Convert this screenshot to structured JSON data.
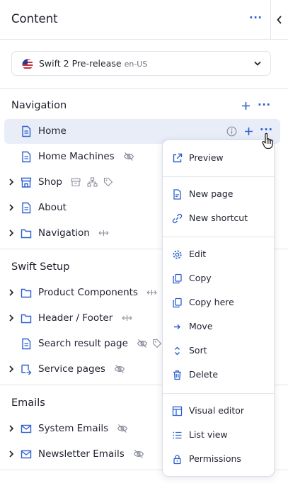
{
  "header": {
    "title": "Content",
    "menu_label": "•••"
  },
  "site_selector": {
    "value": "Swift 2 Pre-release",
    "locale": "en-US"
  },
  "navigation_section": {
    "title": "Navigation",
    "items": [
      {
        "label": "Home"
      },
      {
        "label": "Home Machines"
      },
      {
        "label": "Shop"
      },
      {
        "label": "About"
      },
      {
        "label": "Navigation"
      }
    ]
  },
  "swift_setup_section": {
    "title": "Swift Setup",
    "items": [
      {
        "label": "Product Components"
      },
      {
        "label": "Header / Footer"
      },
      {
        "label": "Search result page"
      },
      {
        "label": "Service pages"
      }
    ]
  },
  "emails_section": {
    "title": "Emails",
    "items": [
      {
        "label": "System Emails"
      },
      {
        "label": "Newsletter Emails"
      }
    ]
  },
  "context_menu": {
    "items": [
      {
        "label": "Preview",
        "icon": "external-link-icon"
      },
      {
        "label": "New page",
        "icon": "new-page-icon"
      },
      {
        "label": "New shortcut",
        "icon": "link-icon"
      },
      {
        "label": "Edit",
        "icon": "gear-icon"
      },
      {
        "label": "Copy",
        "icon": "copy-icon"
      },
      {
        "label": "Copy here",
        "icon": "copy-here-icon"
      },
      {
        "label": "Move",
        "icon": "arrow-right-icon"
      },
      {
        "label": "Sort",
        "icon": "sort-icon"
      },
      {
        "label": "Delete",
        "icon": "trash-icon"
      },
      {
        "label": "Visual editor",
        "icon": "layout-icon"
      },
      {
        "label": "List view",
        "icon": "list-icon"
      },
      {
        "label": "Permissions",
        "icon": "lock-icon"
      }
    ]
  },
  "colors": {
    "accent": "#2a5fd0",
    "selected_row": "#e8edf8",
    "muted_icon": "#8a8f9c"
  }
}
